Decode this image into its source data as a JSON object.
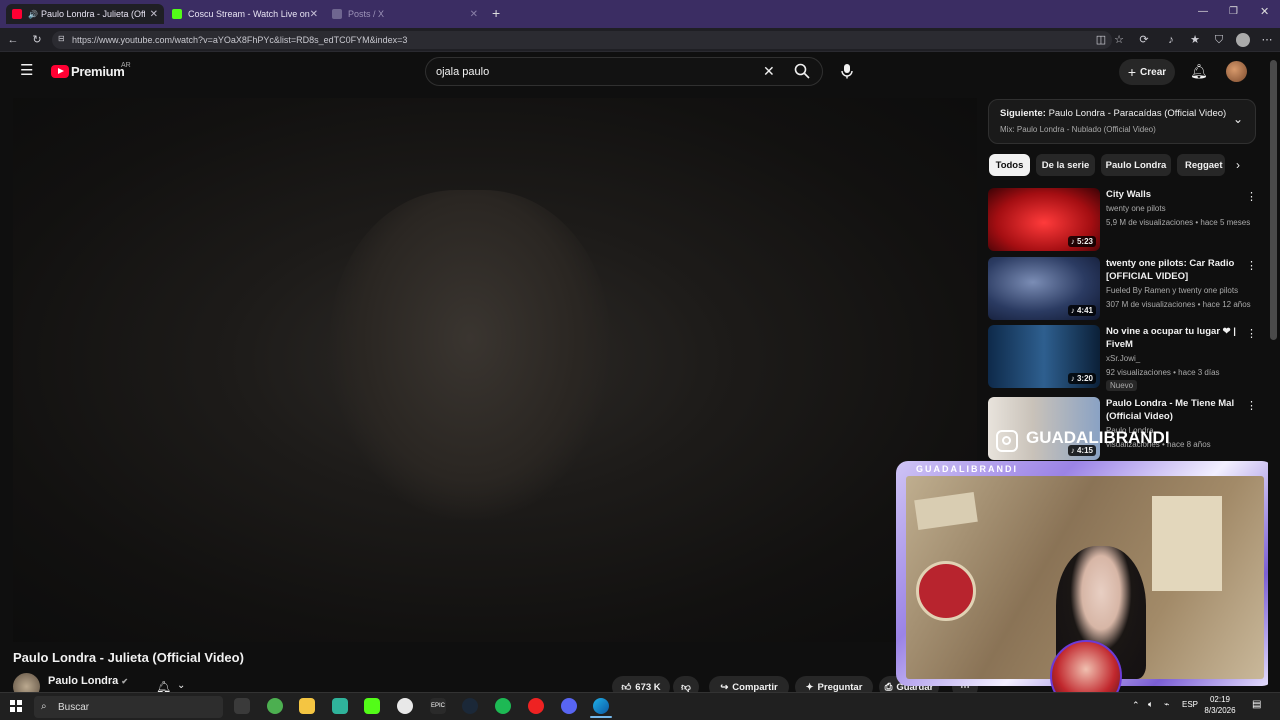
{
  "browser": {
    "tabs": [
      {
        "label": "Paulo Londra - Julieta (Officia",
        "active": true,
        "favicon_color": "#ff0033"
      },
      {
        "label": "Coscu Stream - Watch Live on Kick",
        "active": false,
        "favicon_color": "#53fc18"
      },
      {
        "label": "Posts / X",
        "active": false,
        "favicon_color": "#000000"
      }
    ],
    "new_tab": "+",
    "url": "https://www.youtube.com/watch?v=aYOaX8FhPYc&list=RD8s_edTC0FYM&index=3"
  },
  "youtube": {
    "logo": "Premium",
    "region": "AR",
    "search_value": "ojala paulo",
    "create_label": "Crear"
  },
  "video": {
    "title": "Paulo Londra - Julieta (Official Video)",
    "channel": "Paulo Londra",
    "likes": "673 K",
    "share_label": "Compartir",
    "ask_label": "Preguntar",
    "save_label": "Guardar"
  },
  "playlist": {
    "next_prefix": "Siguiente:",
    "next_title": "Paulo Londra - Paracaídas (Official Video)",
    "mix_label": "Mix: Paulo Londra - Nublado (Official Video)"
  },
  "chips": [
    "Todos",
    "De la serie",
    "Paulo Londra",
    "Reggaet"
  ],
  "recommendations": [
    {
      "title": "City Walls",
      "channel": "twenty one pilots",
      "meta": "5,9 M de visualizaciones • hace 5 meses",
      "duration": "5:23",
      "badge": ""
    },
    {
      "title": "twenty one pilots: Car Radio [OFFICIAL VIDEO]",
      "channel": "Fueled By Ramen  y twenty one pilots",
      "meta": "307 M de visualizaciones • hace 12 años",
      "duration": "4:41",
      "badge": ""
    },
    {
      "title": "No vine a ocupar tu lugar ❤ | FiveM",
      "channel": "xSr.Jowi_",
      "meta": "92 visualizaciones • hace 3 días",
      "duration": "3:20",
      "badge": "Nuevo"
    },
    {
      "title": "Paulo Londra - Me Tiene Mal (Official Video)",
      "channel": "Paulo Londra",
      "meta": "visualizaciones • hace 8 años",
      "duration": "4:15",
      "badge": ""
    }
  ],
  "overlay": {
    "instagram_handle": "GUADALIBRANDI",
    "cam_name": "GUADALIBRANDI"
  },
  "taskbar": {
    "search_label": "Buscar",
    "lang": "ESP",
    "time": "02:19",
    "date": "8/3/2026"
  }
}
